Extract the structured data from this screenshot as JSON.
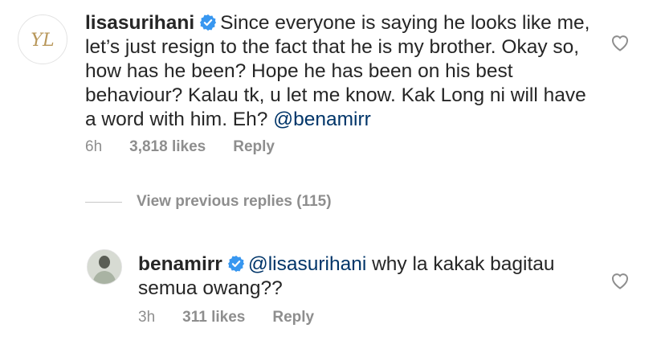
{
  "main_comment": {
    "username": "lisasurihani",
    "text": "Since everyone is saying he looks like me, let’s just resign to the fact that he is my brother. Okay so, how has he been? Hope he has been on his best behaviour? Kalau tk, u let me know. Kak Long ni will have a word with him. Eh? ",
    "mention": "@benamirr",
    "time": "6h",
    "likes": "3,818 likes",
    "reply_label": "Reply",
    "avatar_monogram": "YL"
  },
  "view_previous": {
    "label": "View previous replies (115)"
  },
  "reply_comment": {
    "username": "benamirr",
    "mention": "@lisasurihani",
    "text": " why la kakak bagitau semua owang??",
    "time": "3h",
    "likes": "311 likes",
    "reply_label": "Reply"
  },
  "colors": {
    "verified": "#3897f0",
    "mention": "#003569",
    "meta": "#8e8e8e",
    "monogram": "#b8975a"
  }
}
